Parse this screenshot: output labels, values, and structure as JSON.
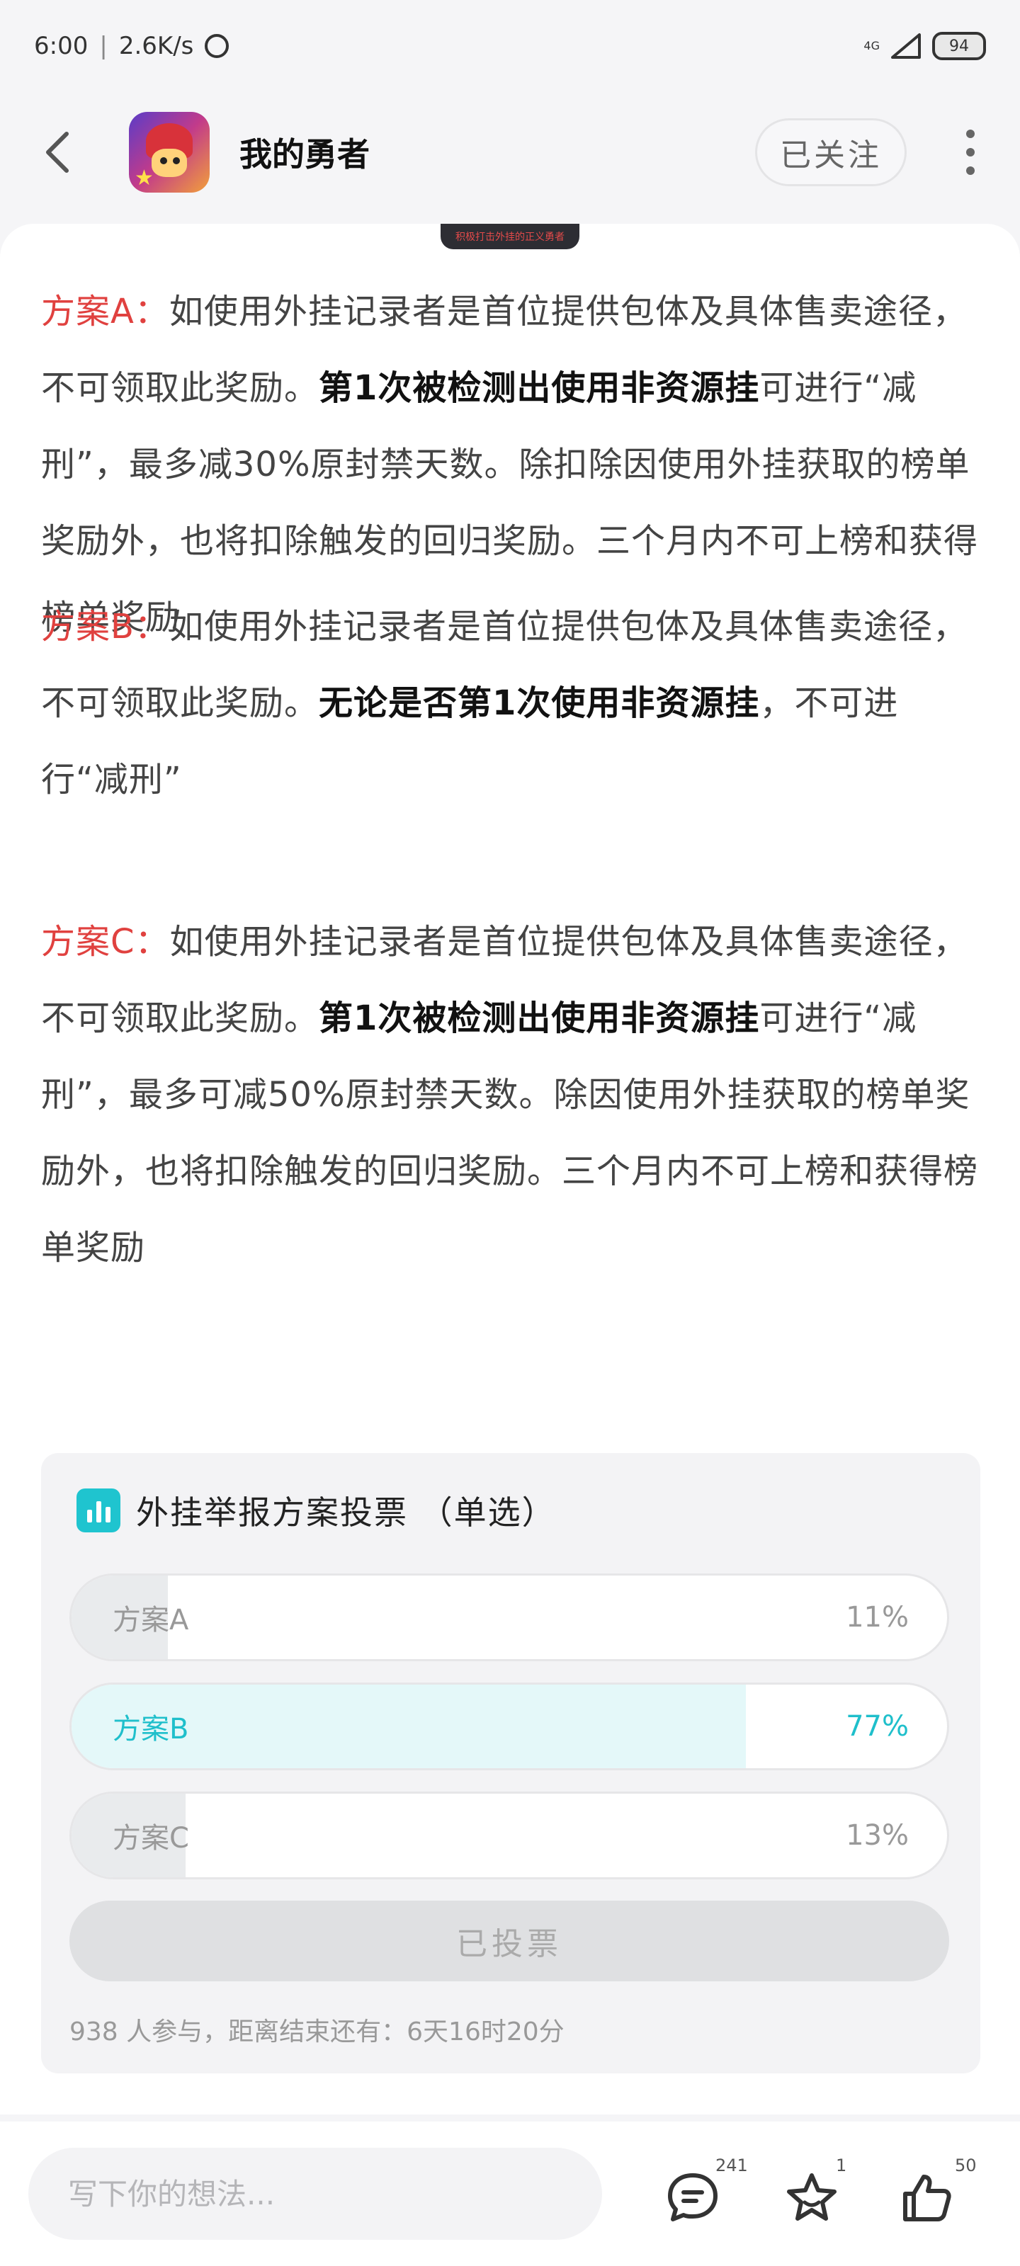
{
  "status_bar": {
    "time": "6:00",
    "separator": "|",
    "speed": "2.6K/s",
    "network": "4G",
    "battery": "94"
  },
  "header": {
    "title": "我的勇者",
    "follow_label": "已关注"
  },
  "banner_tag": "积极打击外挂的正义勇者",
  "plans": [
    {
      "label": "方案A：",
      "text1": "如使用外挂记录者是首位提供包体及具体售卖途径，不可领取此奖励。",
      "bold": "第1次被检测出使用非资源挂",
      "text2": "可进行“减刑”，最多减30%原封禁天数。除扣除因使用外挂获取的榜单奖励外，也将扣除触发的回归奖励。三个月内不可上榜和获得榜单奖励"
    },
    {
      "label": "方案B：",
      "text1": "如使用外挂记录者是首位提供包体及具体售卖途径，不可领取此奖励。",
      "bold": "无论是否第1次使用非资源挂",
      "text2": "，不可进行“减刑”"
    },
    {
      "label": "方案C：",
      "text1": "如使用外挂记录者是首位提供包体及具体售卖途径，不可领取此奖励。",
      "bold": "第1次被检测出使用非资源挂",
      "text2": "可进行“减刑”，最多可减50%原封禁天数。除因使用外挂获取的榜单奖励外，也将扣除触发的回归奖励。三个月内不可上榜和获得榜单奖励"
    }
  ],
  "poll": {
    "title": "外挂举报方案投票 （单选）",
    "options": [
      {
        "label": "方案A",
        "percent": "11%",
        "fraction": 0.11,
        "selected": false
      },
      {
        "label": "方案B",
        "percent": "77%",
        "fraction": 0.77,
        "selected": true
      },
      {
        "label": "方案C",
        "percent": "13%",
        "fraction": 0.13,
        "selected": false
      }
    ],
    "voted_label": "已投票",
    "footer": "938 人参与，距离结束还有：6天16时20分"
  },
  "bottom_bar": {
    "input_placeholder": "写下你的想法...",
    "comment_count": "241",
    "favorite_count": "1",
    "like_count": "50"
  },
  "colors": {
    "accent": "#1fc4cf",
    "plan_label": "#e0413f"
  },
  "icons": [
    "back-arrow-icon",
    "more-dots-icon",
    "poll-chart-icon",
    "comment-icon",
    "star-icon",
    "thumb-up-icon"
  ]
}
